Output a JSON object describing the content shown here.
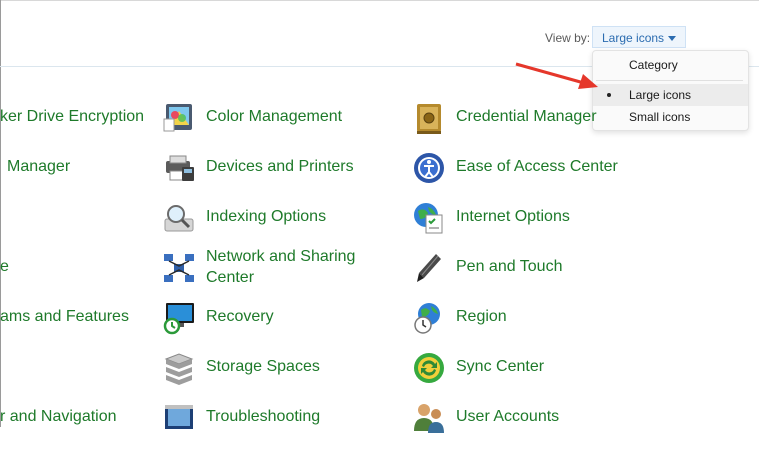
{
  "header": {
    "view_by_label": "View by:",
    "view_by_value": "Large icons"
  },
  "view_menu": {
    "items": [
      {
        "label": "Category",
        "selected": false
      },
      {
        "label": "Large icons",
        "selected": true
      },
      {
        "label": "Small icons",
        "selected": false
      }
    ]
  },
  "items": {
    "col0": [
      "ker Drive Encryption",
      "Manager",
      "e",
      "ams and Features",
      "r and Navigation"
    ],
    "col1": [
      "Color Management",
      "Devices and Printers",
      "Indexing Options",
      "Network and Sharing\nCenter",
      "Recovery",
      "Storage Spaces",
      "Troubleshooting"
    ],
    "col2": [
      "Credential Manager",
      "Ease of Access Center",
      "Internet Options",
      "Pen and Touch",
      "Region",
      "Sync Center",
      "User Accounts"
    ]
  },
  "colors": {
    "link_green": "#1e7a2a",
    "view_blue": "#2b6cb0",
    "annotation_red": "#e5372b"
  }
}
